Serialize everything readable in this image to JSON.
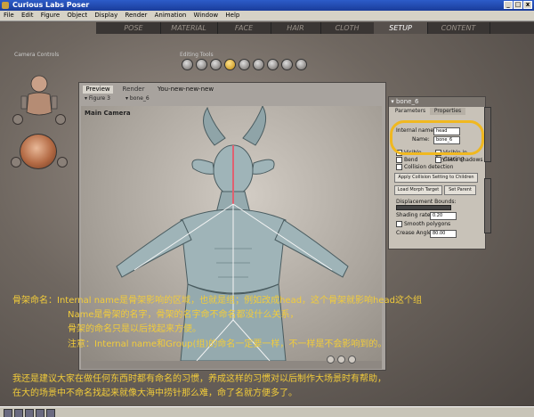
{
  "window": {
    "title": "Curious Labs Poser",
    "ctrl_min": "_",
    "ctrl_max": "□",
    "ctrl_close": "x"
  },
  "menu": [
    "File",
    "Edit",
    "Figure",
    "Object",
    "Display",
    "Render",
    "Animation",
    "Window",
    "Help"
  ],
  "rooms": [
    {
      "label": "POSE",
      "active": false
    },
    {
      "label": "MATERIAL",
      "active": false
    },
    {
      "label": "FACE",
      "active": false
    },
    {
      "label": "HAIR",
      "active": false
    },
    {
      "label": "CLOTH",
      "active": false
    },
    {
      "label": "SETUP",
      "active": true
    },
    {
      "label": "CONTENT",
      "active": false
    }
  ],
  "camera_controls_label": "Camera Controls",
  "editing_tools_label": "Editing Tools",
  "preview": {
    "tab_preview": "Preview",
    "tab_render": "Render",
    "document_name": "You-new-new-new",
    "figure_select": "Figure 3",
    "actor_select": "bone_6",
    "viewport_label": "Main Camera"
  },
  "panel": {
    "title": "bone_6",
    "tab_parameters": "Parameters",
    "tab_properties": "Properties",
    "internal_name_label": "Internal name:",
    "internal_name_value": "head",
    "name_label": "Name:",
    "name_value": "bone_6",
    "visible_label": "Visible",
    "visible_in_raytracing_label": "Visible in Raytracing",
    "bend_label": "Bend",
    "casts_shadows_label": "Casts shadows",
    "collision_detection_label": "Collision detection",
    "apply_collision_button": "Apply Collision Setting to Children",
    "load_morph_button": "Load Morph Target",
    "set_parent_button": "Set Parent",
    "displacement_label": "Displacement Bounds:",
    "shading_rate_label": "Shading rate:",
    "shading_rate_value": "0.20",
    "smooth_polygons_label": "Smooth polygons",
    "crease_angle_label": "Crease Angle:",
    "crease_angle_value": "80.00"
  },
  "annotations": {
    "line1": "骨架命名：Internal name是骨架影响的区域，也就是组；例如改成head，这个骨架就影响head这个组",
    "line2": "Name是骨架的名字，骨架的名字命不命名都没什么关系，",
    "line3": "骨架的命名只是以后找起来方便。",
    "line4": "注意：Internal name和Group(组)的命名一定要一样，不一样是不会影响到的。",
    "line5": "我还是建议大家在做任何东西时都有命名的习惯，养成这样的习惯对以后制作大场景时有帮助，",
    "line6": "在大的场景中不命名找起来就像大海中捞针那么难，命了名就方便多了。"
  },
  "colors": {
    "accent_highlight": "#f0b820",
    "annotation_text": "#f2cc3a",
    "figure_skin": "#9fb4b8"
  }
}
